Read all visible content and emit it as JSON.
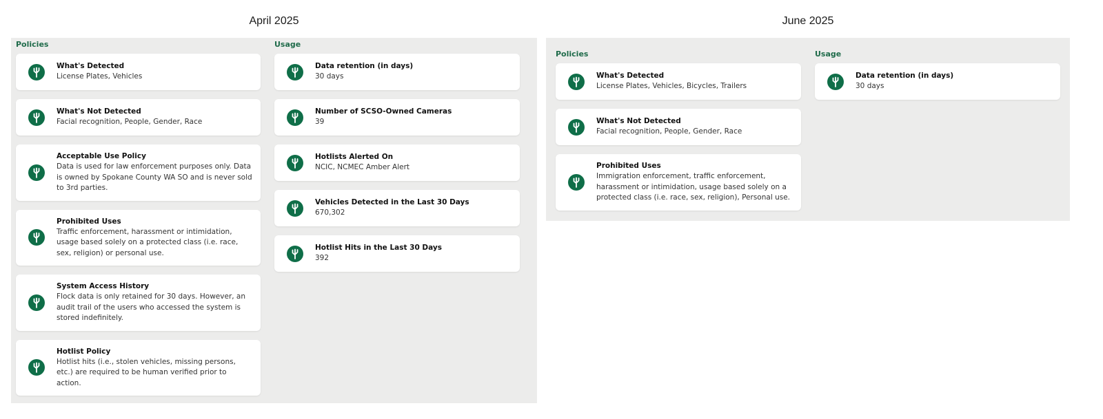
{
  "april": {
    "title": "April 2025",
    "policies": {
      "label": "Policies",
      "cards": [
        {
          "title": "What's Detected",
          "value": "License Plates, Vehicles"
        },
        {
          "title": "What's Not Detected",
          "value": "Facial recognition, People, Gender, Race"
        },
        {
          "title": "Acceptable Use Policy",
          "value": "Data is used for law enforcement purposes only. Data is owned by Spokane County WA SO and is never sold to 3rd parties."
        },
        {
          "title": "Prohibited Uses",
          "value": "Traffic enforcement, harassment or intimidation, usage based solely on a protected class (i.e. race, sex, religion) or personal use."
        },
        {
          "title": "System Access History",
          "value": "Flock data is only retained for 30 days. However, an audit trail of the users who accessed the system is stored indefinitely."
        },
        {
          "title": "Hotlist Policy",
          "value": "Hotlist hits (i.e., stolen vehicles, missing persons, etc.) are required to be human verified prior to action."
        }
      ]
    },
    "usage": {
      "label": "Usage",
      "cards": [
        {
          "title": "Data retention (in days)",
          "value": "30 days"
        },
        {
          "title": "Number of SCSO-Owned Cameras",
          "value": "39"
        },
        {
          "title": "Hotlists Alerted On",
          "value": "NCIC, NCMEC Amber Alert"
        },
        {
          "title": "Vehicles Detected in the Last 30 Days",
          "value": "670,302"
        },
        {
          "title": "Hotlist Hits in the Last 30 Days",
          "value": "392"
        }
      ]
    }
  },
  "june": {
    "title": "June 2025",
    "policies": {
      "label": "Policies",
      "cards": [
        {
          "title": "What's Detected",
          "value": "License Plates, Vehicles, Bicycles, Trailers"
        },
        {
          "title": "What's Not Detected",
          "value": "Facial recognition, People, Gender, Race"
        },
        {
          "title": "Prohibited Uses",
          "value": "Immigration enforcement, traffic enforcement, harassment or intimidation, usage based solely on a protected class (i.e. race, sex, religion), Personal use."
        }
      ]
    },
    "usage": {
      "label": "Usage",
      "cards": [
        {
          "title": "Data retention (in days)",
          "value": "30 days"
        }
      ]
    }
  },
  "icon": "flock-tree-icon",
  "colors": {
    "accent": "#0f6e48",
    "section_label": "#1f6b4a",
    "panel_bg": "#ececeb",
    "card_bg": "#ffffff"
  }
}
